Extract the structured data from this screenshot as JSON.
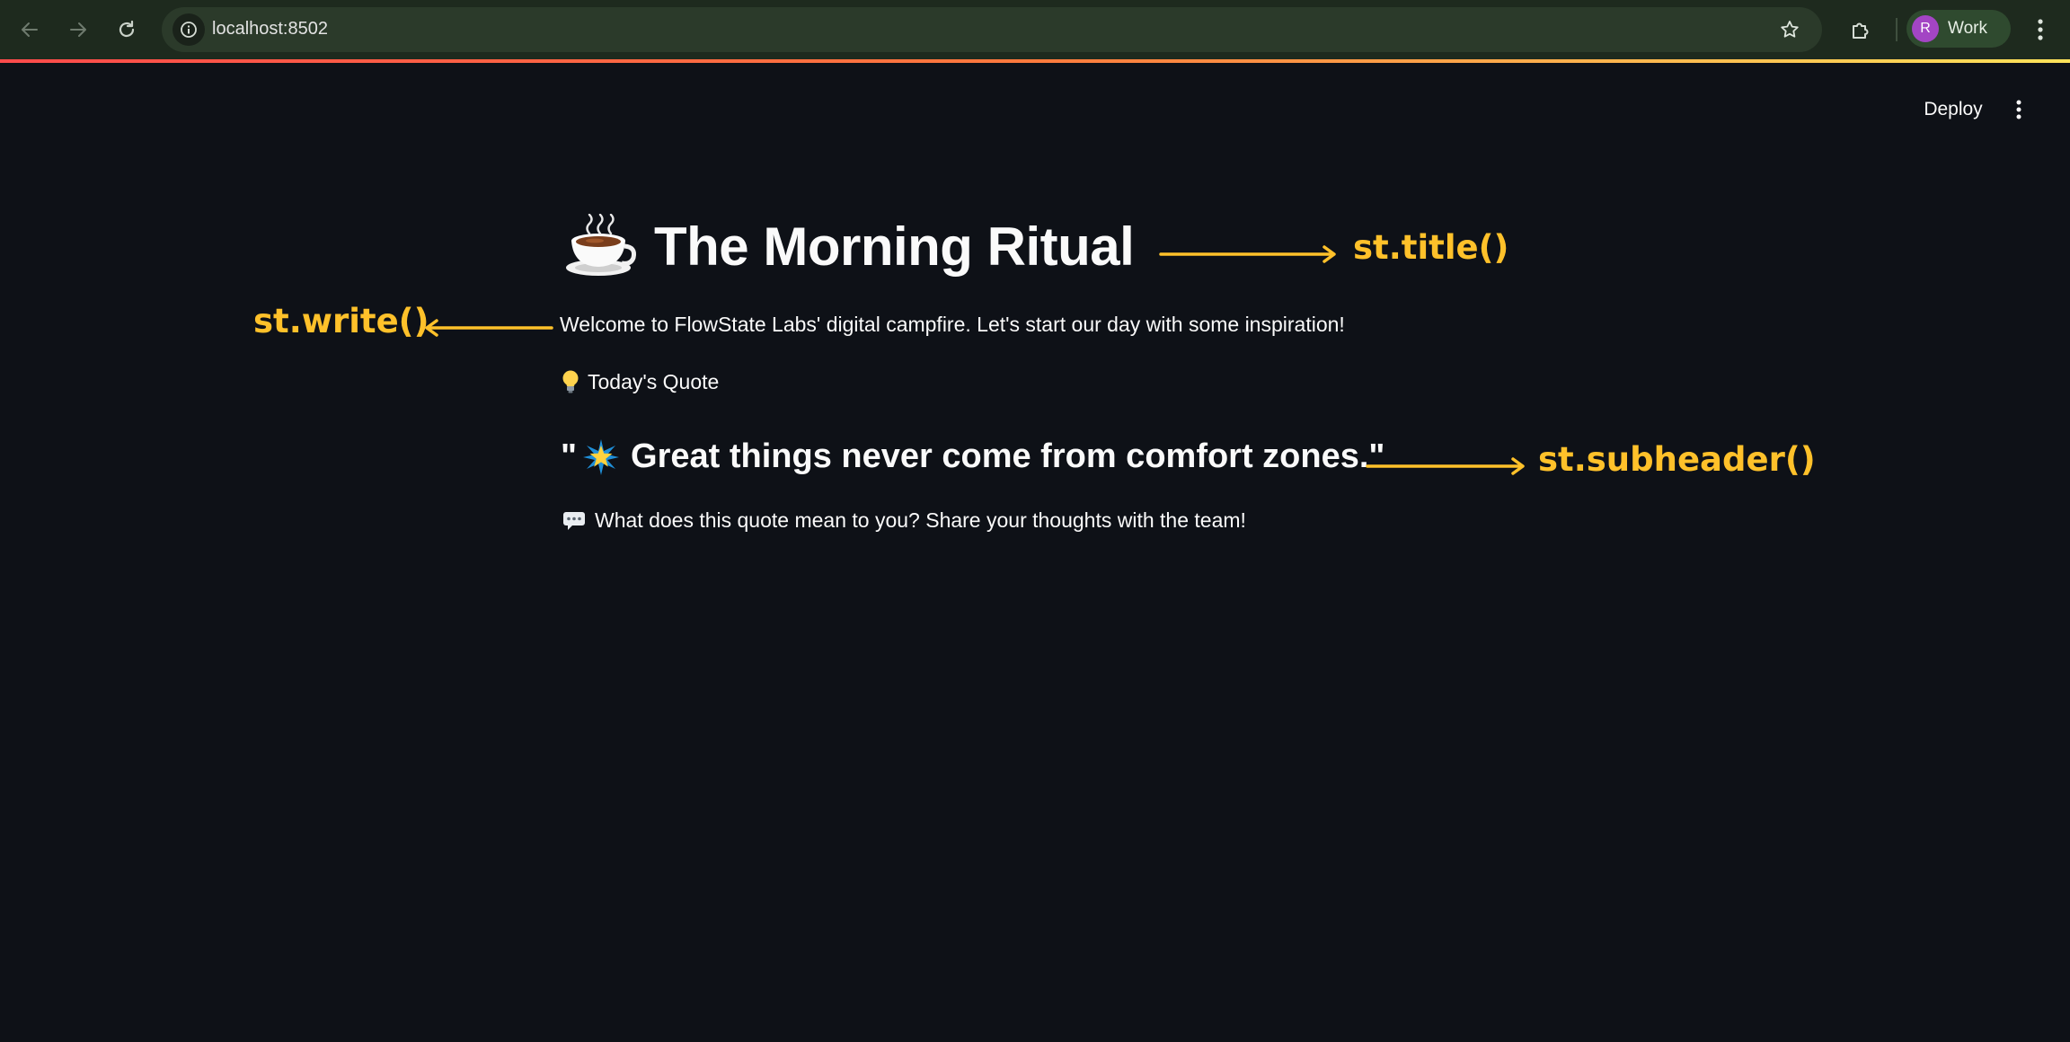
{
  "browser": {
    "url": "localhost:8502",
    "profile_initial": "R",
    "profile_label": "Work"
  },
  "header": {
    "deploy_label": "Deploy"
  },
  "main": {
    "title": "The Morning Ritual",
    "title_icon": "coffee-cup-icon",
    "welcome": "Welcome to FlowState Labs' digital campfire. Let's start our day with some inspiration!",
    "quote_label": "Today's Quote",
    "quote_label_icon": "lightbulb-icon",
    "quote_open": "\"",
    "quote_icon": "glowing-star-icon",
    "quote_text": "Great things never come from comfort zones.\"",
    "share_prompt": "What does this quote mean to you? Share your thoughts with the team!",
    "share_icon": "speech-bubble-icon"
  },
  "annotations": {
    "title_label": "st.title()",
    "write_label": "st.write()",
    "subheader_label": "st.subheader()"
  },
  "colors": {
    "background": "#0e1117",
    "annotation": "#ffc12a",
    "text": "#fafafa",
    "profile_avatar": "#a345c4"
  }
}
